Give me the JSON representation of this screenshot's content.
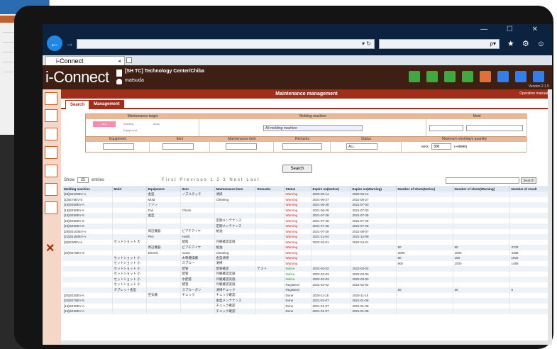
{
  "browser": {
    "address_suffix": "▾ ↻",
    "search_suffix": "ρ▾",
    "window_controls": "— ☐ ✕",
    "toolbar_icons": "⌂ ★ ⚙ ☺",
    "tab_title": "i-Connect",
    "tab_close": "×"
  },
  "app": {
    "logo": "i-Connect",
    "site": "[SH TC] Technology Center/Chiba",
    "user": "matsuda",
    "version": "Version 2.1.5",
    "header_icon_colors": [
      "#3caa3c",
      "#3caa3c",
      "#3caa3c",
      "#3caa3c",
      "#e0703a",
      "#2f80ed",
      "#2f80ed",
      "#2f80ed"
    ]
  },
  "page": {
    "title": "Maintenance management",
    "operation_manual": "Operation manual",
    "tabs": {
      "search": "Search",
      "management": "Management"
    }
  },
  "filter": {
    "headers": {
      "maintenance_target": "Maintenance target",
      "molding_machine": "Molding machine",
      "mold": "Mold",
      "equipment": "Equipment",
      "item": "Item",
      "maintenance_item": "Maintenance item",
      "remarks": "Remarks",
      "status": "Status",
      "max_shot_qty": "Maximum shot/days quantity"
    },
    "target_options": {
      "all": "ALL",
      "molding": "Molding",
      "mold": "Mold",
      "equipment": "Equipment"
    },
    "molding_machine_selected": "All molding machine",
    "status_selected": "ALL",
    "max_shot_value": "300",
    "max_shot_prefix": "MAX",
    "max_shot_suffix": "(~99999)",
    "search_button": "Search"
  },
  "paging": {
    "show_label": "Show",
    "show_value": "25",
    "entries_label": "entries",
    "pages": "First  Previous  1  2  3  Next  Last",
    "search_button": "Search"
  },
  "table": {
    "columns": [
      "Molding machine",
      "Mold",
      "Equipment",
      "Item",
      "Maintenance item",
      "Remarks",
      "Status",
      "Expire on(Notice)",
      "Expire on(Warning)",
      "Number of shots(Notice)",
      "Number of shots(Warning)",
      "Number of result"
    ],
    "rows": [
      [
        "[25]SE100EV-A",
        "",
        "金型",
        "ノズルタッチ",
        "清掃",
        "",
        "Warning",
        "2020-06-14",
        "2020-06-12",
        "",
        "",
        ""
      ],
      [
        "[1]SE75EV-S",
        "",
        "Mold",
        "",
        "Cleaning",
        "",
        "Warning",
        "2021-06-27",
        "2021-06-27",
        "",
        "",
        ""
      ],
      [
        "[15]SE50EV-A",
        "",
        "ファン",
        "",
        "",
        "",
        "Warning",
        "2021-06-28",
        "2021-07-03",
        "",
        "",
        ""
      ],
      [
        "[15]SE50EV-A",
        "",
        "Fan",
        "Check",
        "",
        "",
        "Warning",
        "2021-06-28",
        "2021-07-03",
        "",
        "",
        ""
      ],
      [
        "[15]SE50EV-S",
        "",
        "金型",
        "",
        "",
        "",
        "Warning",
        "2021-07-28",
        "2021-07-28",
        "",
        "",
        ""
      ],
      [
        "[15]SE50EV-S",
        "",
        "",
        "",
        "定期メンテナンス",
        "",
        "Warning",
        "2021-07-28",
        "2021-07-28",
        "",
        "",
        ""
      ],
      [
        "[15]SE50EV-S",
        "",
        "",
        "",
        "定期メンテナンス",
        "",
        "Warning",
        "2021-07-28",
        "2021-07-28",
        "",
        "",
        ""
      ],
      [
        "[20]SE100EV-A",
        "",
        "周辺機器",
        "ビアチアイヤ",
        "給油",
        "",
        "Warning",
        "2021-07-29",
        "2021-08-07",
        "",
        "",
        ""
      ],
      [
        "[21]SE180EV-A",
        "",
        "Peri",
        "Hvish",
        "",
        "",
        "Warning",
        "2021-12-04",
        "2021-12-09",
        "",
        "",
        ""
      ],
      [
        "[3]SE30EV-A",
        "セットショット 大",
        "",
        "給脂",
        "外観確認実施",
        "",
        "Warning",
        "2022-02-01",
        "2022-04-21",
        "",
        "",
        ""
      ],
      [
        "",
        "",
        "周辺機器",
        "ビアチアイヤ",
        "給油",
        "",
        "Warning",
        "",
        "",
        "50",
        "50",
        "4732"
      ],
      [
        "[20]SE75EV-S",
        "",
        "Electric",
        "motor",
        "Cleaning",
        "",
        "Warning",
        "",
        "",
        "2000",
        "1900",
        "4386"
      ],
      [
        "",
        "セットショット 小",
        "",
        "木製機操機",
        "金型清掃",
        "",
        "Warning",
        "",
        "",
        "80",
        "100",
        "1502"
      ],
      [
        "",
        "セットショット 小",
        "",
        "スプルー",
        "清掃",
        "",
        "Warning",
        "",
        "",
        "900",
        "1000",
        "1468"
      ],
      [
        "",
        "セットショット 小",
        "",
        "配管",
        "配管確認",
        "テスト",
        "Notice",
        "2022-02-02",
        "2022-03-02",
        "",
        "",
        ""
      ],
      [
        "",
        "セットショット 小",
        "",
        "配管",
        "外観確認実施",
        "",
        "Notice",
        "2022-02-03",
        "2022-03-03",
        "",
        "",
        ""
      ],
      [
        "",
        "セットショット 小",
        "",
        "水配管",
        "外観確認実施",
        "",
        "Notice",
        "2022-02-03",
        "2022-03-03",
        "",
        "",
        ""
      ],
      [
        "",
        "セットショット 小",
        "",
        "配管",
        "外観確認実施",
        "",
        "Registerd",
        "2022-04-02",
        "2022-02-02",
        "",
        "",
        ""
      ],
      [
        "",
        "タブレット金型",
        "",
        "スプルーガン",
        "清掃チェック",
        "",
        "Registerd",
        "",
        "",
        "20",
        "30",
        "0"
      ],
      [
        "[20]SE30EV-A",
        "",
        "空気機",
        "チェック",
        "チェック確認",
        "",
        "Done",
        "2020-11-15",
        "2020-11-15",
        "",
        "",
        ""
      ],
      [
        "[20]SE75EV-S",
        "",
        "",
        "",
        "金型メンテナンス",
        "",
        "Done",
        "2021-01-07",
        "2021-01-08",
        "",
        "",
        ""
      ],
      [
        "[16]SE30EV-A",
        "",
        "",
        "",
        "チェック確認",
        "",
        "Done",
        "2021-01-07",
        "2021-01-08",
        "",
        "",
        ""
      ],
      [
        "[16]SE30EV-A",
        "",
        "",
        "",
        "チェック確認",
        "",
        "Done",
        "2021-01-07",
        "2021-01-08",
        "",
        "",
        ""
      ]
    ]
  }
}
